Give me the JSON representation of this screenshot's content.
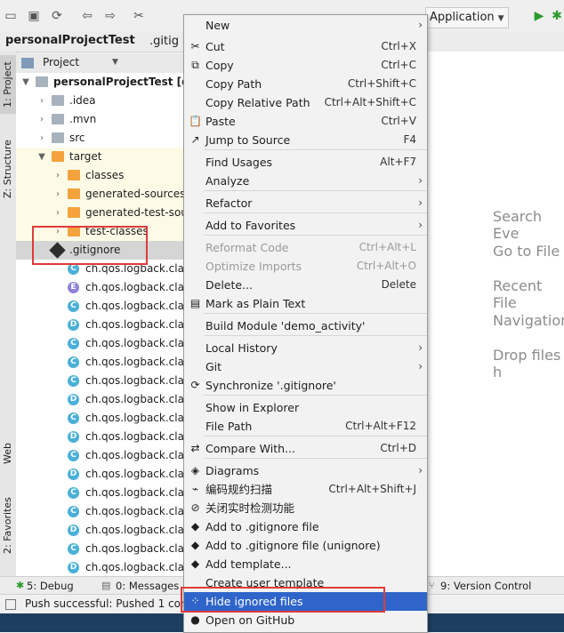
{
  "toolbar": {
    "run_config": "Application",
    "icons": [
      "open-icon",
      "save-icon",
      "sync-icon",
      "back-icon",
      "forward-icon",
      "cut-icon",
      "run-icon",
      "debug-icon"
    ]
  },
  "navbar": {
    "project": "personalProjectTest",
    "file": ".gitig"
  },
  "left_strip": {
    "project_tab": "1: Project",
    "structure_tab": "Z: Structure",
    "web_tab": "Web",
    "favorites_tab": "2: Favorites"
  },
  "project_panel": {
    "title": "Project",
    "tree": [
      {
        "label": "personalProjectTest [dem",
        "bold": true
      },
      {
        "label": ".idea"
      },
      {
        "label": ".mvn"
      },
      {
        "label": "src"
      },
      {
        "label": "target"
      },
      {
        "label": "classes"
      },
      {
        "label": "generated-sources"
      },
      {
        "label": "generated-test-sou"
      },
      {
        "label": "test-classes"
      },
      {
        "label": ".gitignore"
      },
      {
        "label": "ch.qos.logback.classic",
        "icon": "C"
      },
      {
        "label": "ch.qos.logback.classic",
        "icon": "E"
      },
      {
        "label": "ch.qos.logback.classic",
        "icon": "C"
      },
      {
        "label": "ch.qos.logback.classic",
        "icon": "D"
      },
      {
        "label": "ch.qos.logback.classic",
        "icon": "C"
      },
      {
        "label": "ch.qos.logback.classic",
        "icon": "C"
      },
      {
        "label": "ch.qos.logback.classic",
        "icon": "C"
      },
      {
        "label": "ch.qos.logback.classic",
        "icon": "D"
      },
      {
        "label": "ch.qos.logback.classic",
        "icon": "C"
      },
      {
        "label": "ch.qos.logback.classic",
        "icon": "D"
      },
      {
        "label": "ch.qos.logback.classic",
        "icon": "C"
      },
      {
        "label": "ch.qos.logback.classic",
        "icon": "D"
      },
      {
        "label": "ch.qos.logback.classic",
        "icon": "C"
      },
      {
        "label": "ch.qos.logback.classic",
        "icon": "C"
      },
      {
        "label": "ch.qos.logback.classic",
        "icon": "D"
      },
      {
        "label": "ch.qos.logback.classic",
        "icon": "C"
      },
      {
        "label": "ch.qos.logback.classic",
        "icon": "D"
      },
      {
        "label": "ch.qos.logback.classic",
        "icon": "C"
      }
    ]
  },
  "editor_hints": [
    "Search Eve",
    "Go to File",
    "Recent File",
    "Navigation",
    "Drop files h"
  ],
  "bottom_bar": {
    "debug": "5: Debug",
    "messages": "0: Messages",
    "version_control": "9: Version Control"
  },
  "status": {
    "message": "Push successful: Pushed 1 com"
  },
  "menu": {
    "items": [
      {
        "label": "New",
        "submenu": true
      },
      {
        "label": "Cut",
        "shortcut": "Ctrl+X",
        "icon": "cut-icon"
      },
      {
        "label": "Copy",
        "shortcut": "Ctrl+C",
        "icon": "copy-icon"
      },
      {
        "label": "Copy Path",
        "shortcut": "Ctrl+Shift+C"
      },
      {
        "label": "Copy Relative Path",
        "shortcut": "Ctrl+Alt+Shift+C"
      },
      {
        "label": "Paste",
        "shortcut": "Ctrl+V",
        "icon": "paste-icon"
      },
      {
        "label": "Jump to Source",
        "shortcut": "F4",
        "icon": "jump-icon"
      },
      {
        "label": "Find Usages",
        "shortcut": "Alt+F7"
      },
      {
        "label": "Analyze",
        "submenu": true
      },
      {
        "label": "Refactor",
        "submenu": true
      },
      {
        "label": "Add to Favorites",
        "submenu": true
      },
      {
        "label": "Reformat Code",
        "shortcut": "Ctrl+Alt+L",
        "disabled": true
      },
      {
        "label": "Optimize Imports",
        "shortcut": "Ctrl+Alt+O",
        "disabled": true
      },
      {
        "label": "Delete...",
        "shortcut": "Delete"
      },
      {
        "label": "Mark as Plain Text",
        "icon": "plain-text-icon"
      },
      {
        "label": "Build Module 'demo_activity'"
      },
      {
        "label": "Local History",
        "submenu": true
      },
      {
        "label": "Git",
        "submenu": true
      },
      {
        "label": "Synchronize '.gitignore'",
        "icon": "sync-icon"
      },
      {
        "label": "Show in Explorer"
      },
      {
        "label": "File Path",
        "shortcut": "Ctrl+Alt+F12"
      },
      {
        "label": "Compare With...",
        "shortcut": "Ctrl+D",
        "icon": "compare-icon"
      },
      {
        "label": "Diagrams",
        "submenu": true,
        "icon": "diagram-icon"
      },
      {
        "label": "编码规约扫描",
        "shortcut": "Ctrl+Alt+Shift+J",
        "icon": "scan-icon"
      },
      {
        "label": "关闭实时检测功能",
        "icon": "stop-icon"
      },
      {
        "label": "Add to .gitignore file",
        "icon": "gitignore-icon"
      },
      {
        "label": "Add to .gitignore file (unignore)",
        "icon": "gitignore-icon"
      },
      {
        "label": "Add template...",
        "icon": "gitignore-icon"
      },
      {
        "label": "Create user template"
      },
      {
        "label": "Hide ignored files",
        "icon": "hide-icon",
        "highlighted": true
      },
      {
        "label": "Open on GitHub",
        "icon": "github-icon"
      }
    ]
  }
}
